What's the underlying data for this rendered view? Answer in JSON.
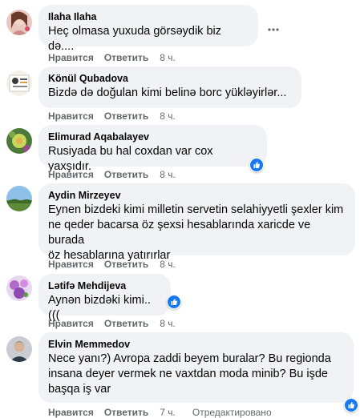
{
  "actions": {
    "like": "Нравится",
    "reply": "Ответить"
  },
  "comments": [
    {
      "name": "Ilaha Ilaha",
      "text": [
        "Heç olmasa yuxuda görsəydik biz də...."
      ],
      "time": "8 ч.",
      "edited": ""
    },
    {
      "name": "Könül Qubadova",
      "text": [
        "Bizdə də doğulan kimi belinə borc yükləyirlər..."
      ],
      "time": "8 ч.",
      "edited": ""
    },
    {
      "name": "Elimurad Aqabalayev",
      "text": [
        "Rusiyada bu hal coxdan var cox yaxşıdır."
      ],
      "time": "8 ч.",
      "edited": ""
    },
    {
      "name": "Aydin Mirzeyev",
      "text": [
        "Eynen bizdeki kimi milletin servetin selahiyyetli şexler kim",
        "ne qeder bacarsa öz şexsi hesablarında xaricde ve burada",
        "öz hesablarına yatırırlar"
      ],
      "time": "8 ч.",
      "edited": ""
    },
    {
      "name": "Lətifə Mehdijeva",
      "text": [
        "Aynən bizdəki kimi..((("
      ],
      "time": "8 ч.",
      "edited": ""
    },
    {
      "name": "Elvin Memmedov",
      "text": [
        "Nece yanı?) Avropa zaddi beyem buralar? Bu regionda",
        "insana deyer vermek ne vaxtdan moda minib? Bu işde",
        "başqa iş var"
      ],
      "time": "7 ч.",
      "edited": "Отредактировано"
    }
  ],
  "icons": {
    "like_badge": "thumbs-up-icon",
    "more": "more-options-icon"
  },
  "colors": {
    "like_blue": "#1877f2",
    "bubble": "#f0f2f5",
    "meta": "#65676b"
  }
}
